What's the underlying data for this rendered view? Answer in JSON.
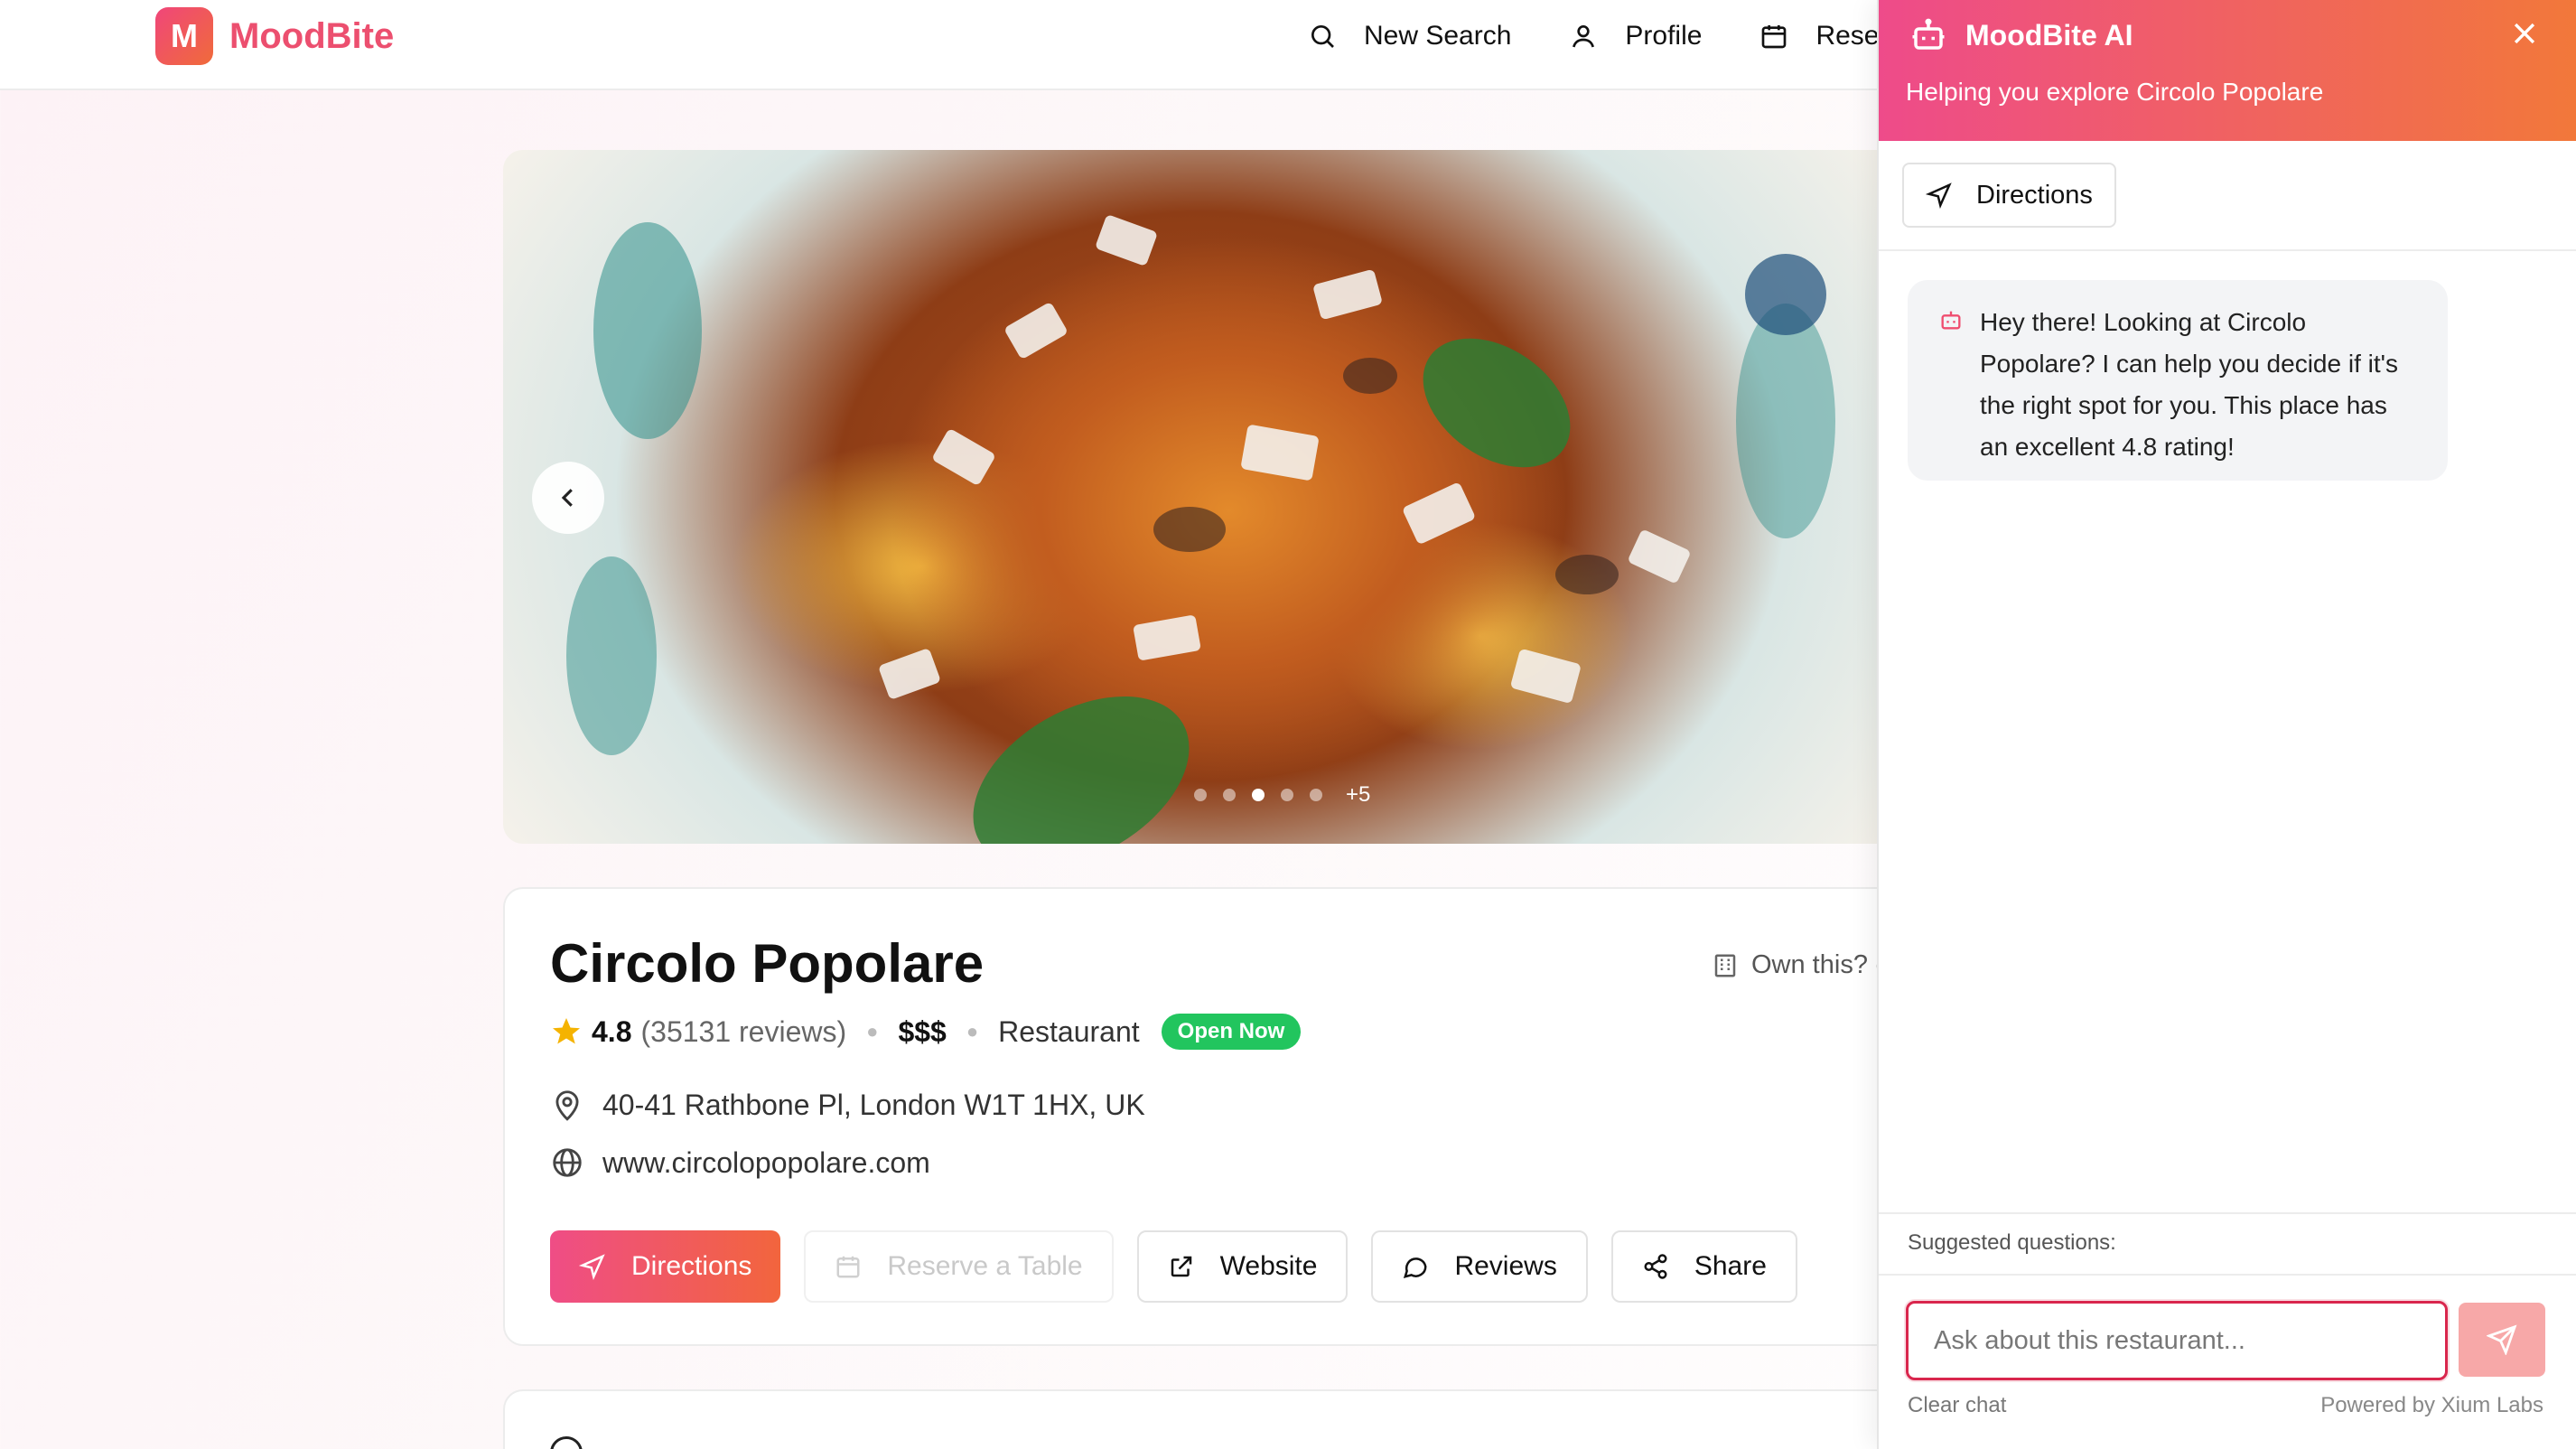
{
  "brand": {
    "logo_letter": "M",
    "name": "MoodBite"
  },
  "nav": {
    "items": [
      {
        "label": "New Search",
        "icon": "search-icon"
      },
      {
        "label": "Profile",
        "icon": "user-icon"
      },
      {
        "label": "Rese",
        "icon": "calendar-icon"
      }
    ]
  },
  "carousel": {
    "more_label": "+5",
    "active_dot": 3,
    "dot_count": 6
  },
  "restaurant": {
    "name": "Circolo Popolare",
    "own_this": "Own this? (",
    "rating": "4.8",
    "reviews": "(35131 reviews)",
    "price": "$$$",
    "category": "Restaurant",
    "status": "Open Now",
    "address": "40-41 Rathbone Pl, London W1T 1HX, UK",
    "website": "www.circolopopolare.com"
  },
  "actions": {
    "directions": "Directions",
    "reserve": "Reserve a Table",
    "website": "Website",
    "reviews": "Reviews",
    "share": "Share"
  },
  "chat": {
    "title": "MoodBite AI",
    "subtitle": "Helping you explore Circolo Popolare",
    "quick_action": "Directions",
    "message": "Hey there! Looking at Circolo Popolare? I can help you decide if it's the right spot for you. This place has an excellent 4.8 rating!",
    "suggested_label": "Suggested questions:",
    "input_placeholder": "Ask about this restaurant...",
    "clear": "Clear chat",
    "powered_by": "Powered by Xium Labs"
  },
  "colors": {
    "brand_gradient_start": "#ef4d86",
    "brand_gradient_end": "#f2653d",
    "open_badge": "#22c55e",
    "input_focus": "#d9264d"
  }
}
